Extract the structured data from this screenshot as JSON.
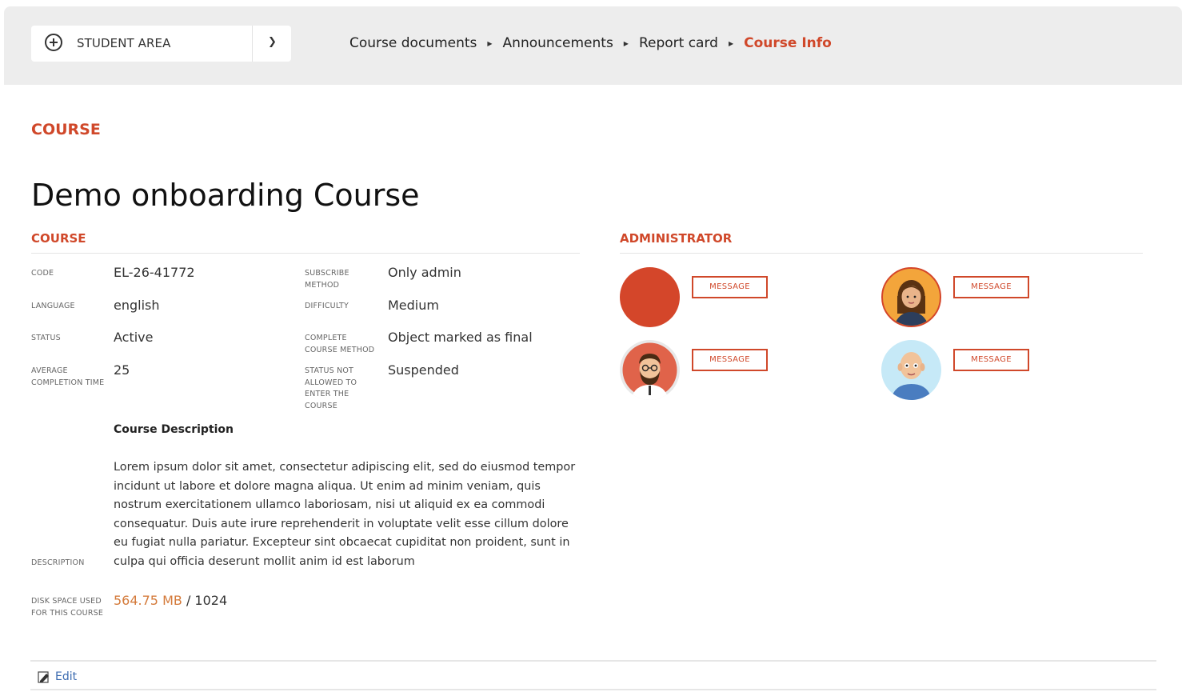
{
  "header": {
    "area_label": "STUDENT AREA",
    "breadcrumbs": [
      {
        "label": "Course documents"
      },
      {
        "label": "Announcements"
      },
      {
        "label": "Report card"
      },
      {
        "label": "Course Info"
      }
    ]
  },
  "kicker": "COURSE",
  "title": "Demo onboarding Course",
  "course_section": {
    "title": "COURSE",
    "code_label": "CODE",
    "code": "EL-26-41772",
    "language_label": "LANGUAGE",
    "language": "english",
    "status_label": "STATUS",
    "status": "Active",
    "avg_time_label": "AVERAGE COMPLETION TIME",
    "avg_time": "25",
    "subscribe_label": "SUBSCRIBE METHOD",
    "subscribe": "Only admin",
    "difficulty_label": "DIFFICULTY",
    "difficulty": "Medium",
    "complete_label": "COMPLETE COURSE METHOD",
    "complete": "Object marked as final",
    "not_allowed_label": "STATUS NOT ALLOWED TO ENTER THE COURSE",
    "not_allowed": "Suspended",
    "desc_heading": "Course Description",
    "description_label": "DESCRIPTION",
    "description": "Lorem ipsum dolor sit amet, consectetur adipiscing elit, sed do eiusmod tempor incidunt ut labore et dolore magna aliqua. Ut enim ad minim veniam, quis nostrum exercitationem ullamco laboriosam, nisi ut aliquid ex ea commodi consequatur. Duis aute irure reprehenderit in voluptate velit esse cillum dolore eu fugiat nulla pariatur. Excepteur sint obcaecat cupiditat non proident, sunt in culpa qui officia deserunt mollit anim id est laborum",
    "disk_label": "DISK SPACE USED FOR THIS COURSE",
    "disk_used": "564.75 MB",
    "disk_total": " / 1024"
  },
  "admin_section": {
    "title": "ADMINISTRATOR",
    "message_label": "MESSAGE"
  },
  "footer": {
    "edit_label": "Edit"
  },
  "colors": {
    "accent": "#d0482a",
    "disk": "#d47a3a",
    "link": "#3c6bb0"
  }
}
